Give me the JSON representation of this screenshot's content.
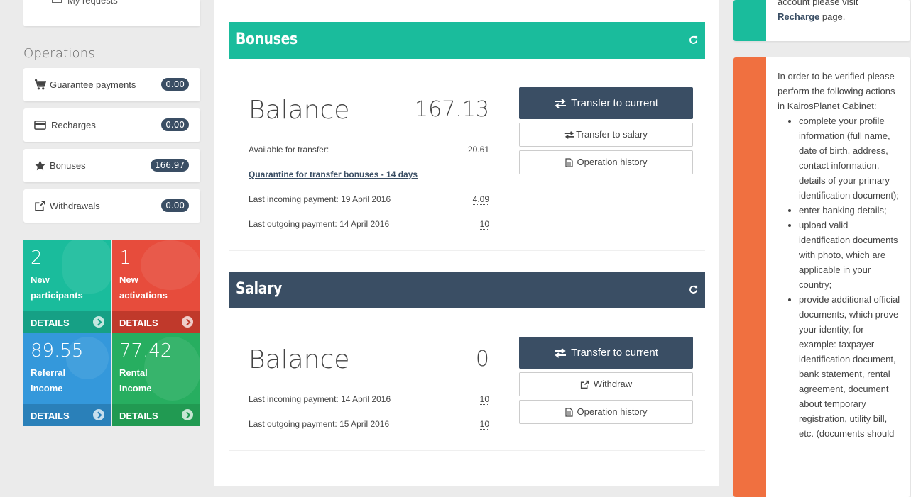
{
  "sidebar": {
    "top_link": "My requests",
    "operations_title": "Operations",
    "operations": [
      {
        "label": "Guarantee payments",
        "badge": "0.00",
        "icon": "cart-icon"
      },
      {
        "label": "Recharges",
        "badge": "0.00",
        "icon": "credit-card-icon"
      },
      {
        "label": "Bonuses",
        "badge": "166.97",
        "icon": "star-icon"
      },
      {
        "label": "Withdrawals",
        "badge": "0.00",
        "icon": "share-icon"
      }
    ],
    "tiles": [
      {
        "value": "2",
        "line1": "New",
        "line2": "participants",
        "details": "DETAILS",
        "color": "#1abc9c",
        "foot": "#16a085"
      },
      {
        "value": "1",
        "line1": "New",
        "line2": "activations",
        "details": "DETAILS",
        "color": "#e74c3c",
        "foot": "#c0392b"
      },
      {
        "value": "89.55",
        "line1": "Referral",
        "line2": "Income",
        "details": "DETAILS",
        "color": "#3498db",
        "foot": "#2a80b9"
      },
      {
        "value": "77.42",
        "line1": "Rental",
        "line2": "Income",
        "details": "DETAILS",
        "color": "#27ae60",
        "foot": "#219a52"
      }
    ]
  },
  "bonuses": {
    "title": "Bonuses",
    "color": "#1abc9c",
    "balance_label": "Balance",
    "balance_value": "167.13",
    "available_label": "Available for transfer:",
    "available_value": "20.61",
    "quarantine_link": "Quarantine for transfer bonuses - 14 days",
    "last_in_label": "Last incoming payment: 19 April 2016",
    "last_in_value": "4.09",
    "last_out_label": "Last outgoing payment: 14 April 2016",
    "last_out_value": "10",
    "btn_transfer_current": "Transfer to current",
    "btn_transfer_salary": "Transfer to salary",
    "btn_history": "Operation history"
  },
  "salary": {
    "title": "Salary",
    "color": "#3a4e64",
    "balance_label": "Balance",
    "balance_value": "0",
    "last_in_label": "Last incoming payment: 14 April 2016",
    "last_in_value": "10",
    "last_out_label": "Last outgoing payment: 15 April 2016",
    "last_out_value": "10",
    "btn_transfer_current": "Transfer to current",
    "btn_withdraw": "Withdraw",
    "btn_history": "Operation history"
  },
  "right": {
    "top_text_1": "account please visit",
    "top_link": "Recharge",
    "top_text_2": " page.",
    "verify_intro": "In order to be verified please perform the following actions in KairosPlanet Cabinet:",
    "verify_items": [
      "complete your profile information (full name, date of birth, address, contact information, details of your primary identification document);",
      "enter banking details;",
      "upload valid identification documents with photo, which are applicable in your country;",
      "provide additional official documents, which prove your identity, for example: taxpayer identification document, bank statement, rental agreement, document about temporary registration, utility bill, etc. (documents should"
    ],
    "top_strip_color": "#1abc9c",
    "verify_strip_color": "#f07040"
  }
}
